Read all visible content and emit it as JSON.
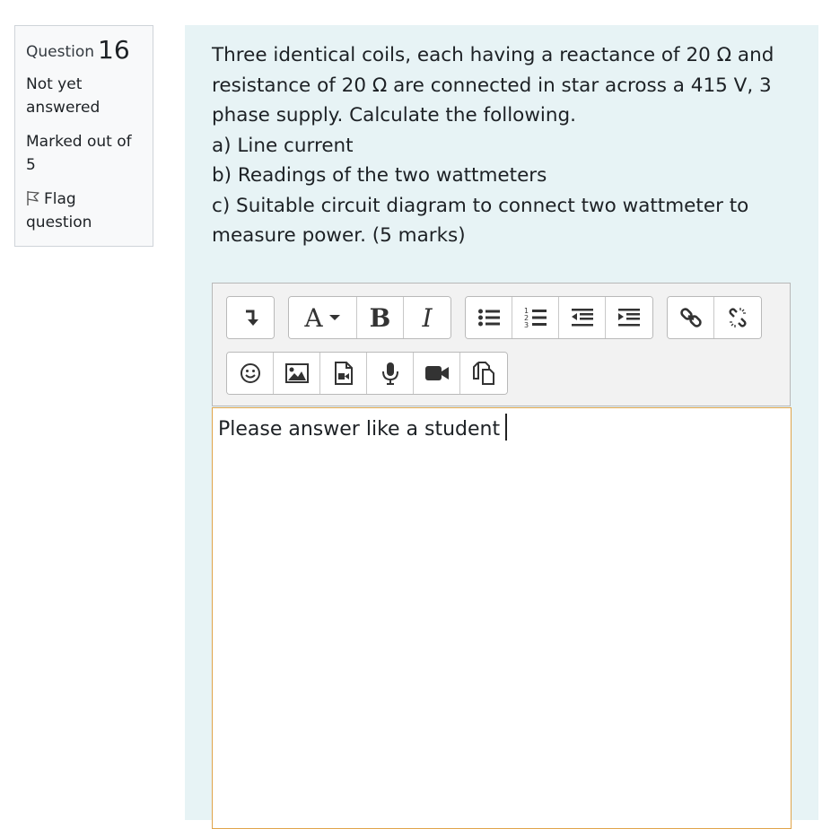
{
  "info": {
    "question_label": "Question",
    "question_number": "16",
    "state": "Not yet answered",
    "grade": "Marked out of 5",
    "flag_label": "Flag question"
  },
  "question": {
    "lines": [
      "Three identical coils, each having a reactance of 20 Ω and resistance of 20 Ω are connected in star across a 415 V, 3 phase supply. Calculate the following.",
      "a) Line current",
      "b) Readings of the two wattmeters",
      "c) Suitable circuit diagram to connect two wattmeter to measure power.  (5 marks)"
    ]
  },
  "toolbar": {
    "bold_glyph": "B",
    "italic_glyph": "I",
    "font_glyph": "A",
    "icons": [
      "show-more-icon",
      "font-color-icon",
      "bold-icon",
      "italic-icon",
      "unordered-list-icon",
      "ordered-list-icon",
      "outdent-icon",
      "indent-icon",
      "link-icon",
      "unlink-icon",
      "emoji-icon",
      "image-icon",
      "media-icon",
      "record-audio-icon",
      "record-video-icon",
      "manage-files-icon"
    ]
  },
  "answer": {
    "text": "Please answer like a student"
  },
  "colors": {
    "question_bg": "#e7f3f5",
    "answer_border": "#e0a44a",
    "info_bg": "#f8f9fa"
  }
}
